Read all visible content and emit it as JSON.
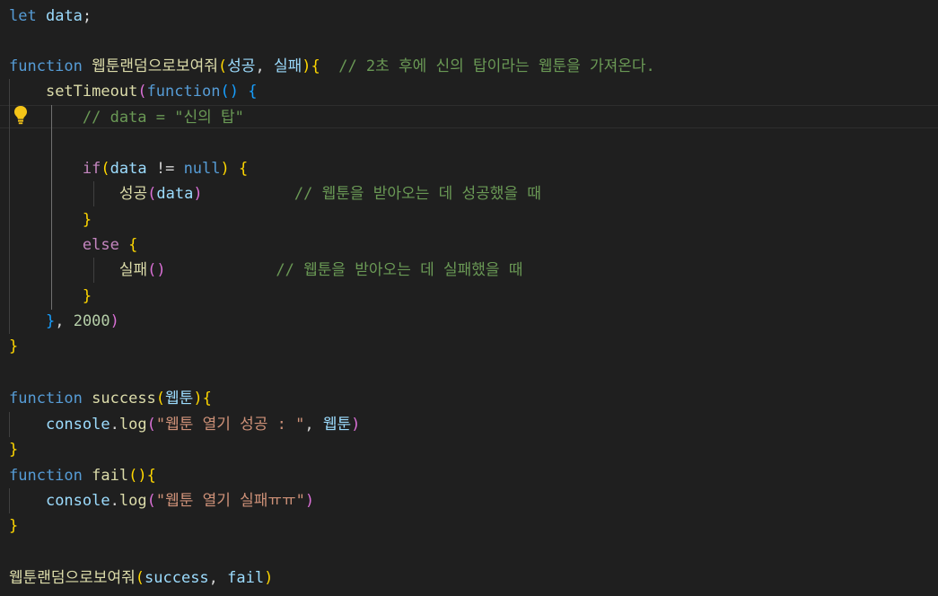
{
  "editor": {
    "lines": {
      "l1": {
        "kw": "let",
        "var": "data",
        "semi": ";"
      },
      "l3": {
        "kw": "function",
        "name": "웹툰랜덤으로보여줘",
        "open": "(",
        "p1": "성공",
        "comma": ",",
        "p2": "실패",
        "close": ")",
        "brace": "{",
        "comment": "// 2초 후에 신의 탑이라는 웹툰을 가져온다."
      },
      "l4": {
        "fn": "setTimeout",
        "open": "(",
        "kw": "function",
        "parens": "()",
        "brace": "{"
      },
      "l5": {
        "comment": "// data = \"신의 탑\""
      },
      "l7": {
        "kw": "if",
        "open": "(",
        "var": "data",
        "op": "!=",
        "null": "null",
        "close": ")",
        "brace": "{"
      },
      "l8": {
        "fn": "성공",
        "open": "(",
        "var": "data",
        "close": ")",
        "comment": "// 웹툰을 받아오는 데 성공했을 때"
      },
      "l9": {
        "brace": "}"
      },
      "l10": {
        "kw": "else",
        "brace": "{"
      },
      "l11": {
        "fn": "실패",
        "parens": "()",
        "comment": "// 웹툰을 받아오는 데 실패했을 때"
      },
      "l12": {
        "brace": "}"
      },
      "l13": {
        "brace": "}",
        "comma": ",",
        "num": "2000",
        "close": ")"
      },
      "l14": {
        "brace": "}"
      },
      "l16": {
        "kw": "function",
        "name": "success",
        "open": "(",
        "param": "웹툰",
        "close": ")",
        "brace": "{"
      },
      "l17": {
        "obj": "console",
        "dot": ".",
        "fn": "log",
        "open": "(",
        "str": "\"웹툰 열기 성공 : \"",
        "comma": ",",
        "var": "웹툰",
        "close": ")"
      },
      "l18": {
        "brace": "}"
      },
      "l19": {
        "kw": "function",
        "name": "fail",
        "parens": "()",
        "brace": "{"
      },
      "l20": {
        "obj": "console",
        "dot": ".",
        "fn": "log",
        "open": "(",
        "str": "\"웹툰 열기 실패ㅠㅠ\"",
        "close": ")"
      },
      "l21": {
        "brace": "}"
      },
      "l23": {
        "fn": "웹툰랜덤으로보여줘",
        "open": "(",
        "a1": "success",
        "comma": ",",
        "a2": "fail",
        "close": ")"
      }
    },
    "icons": {
      "lightbulb": "lightbulb-icon"
    },
    "colors": {
      "background": "#1f1f1f",
      "keyword": "#569cd6",
      "function": "#dcdcaa",
      "comment": "#6a9955",
      "string": "#ce9178",
      "bracket_gold": "#ffd700"
    }
  }
}
